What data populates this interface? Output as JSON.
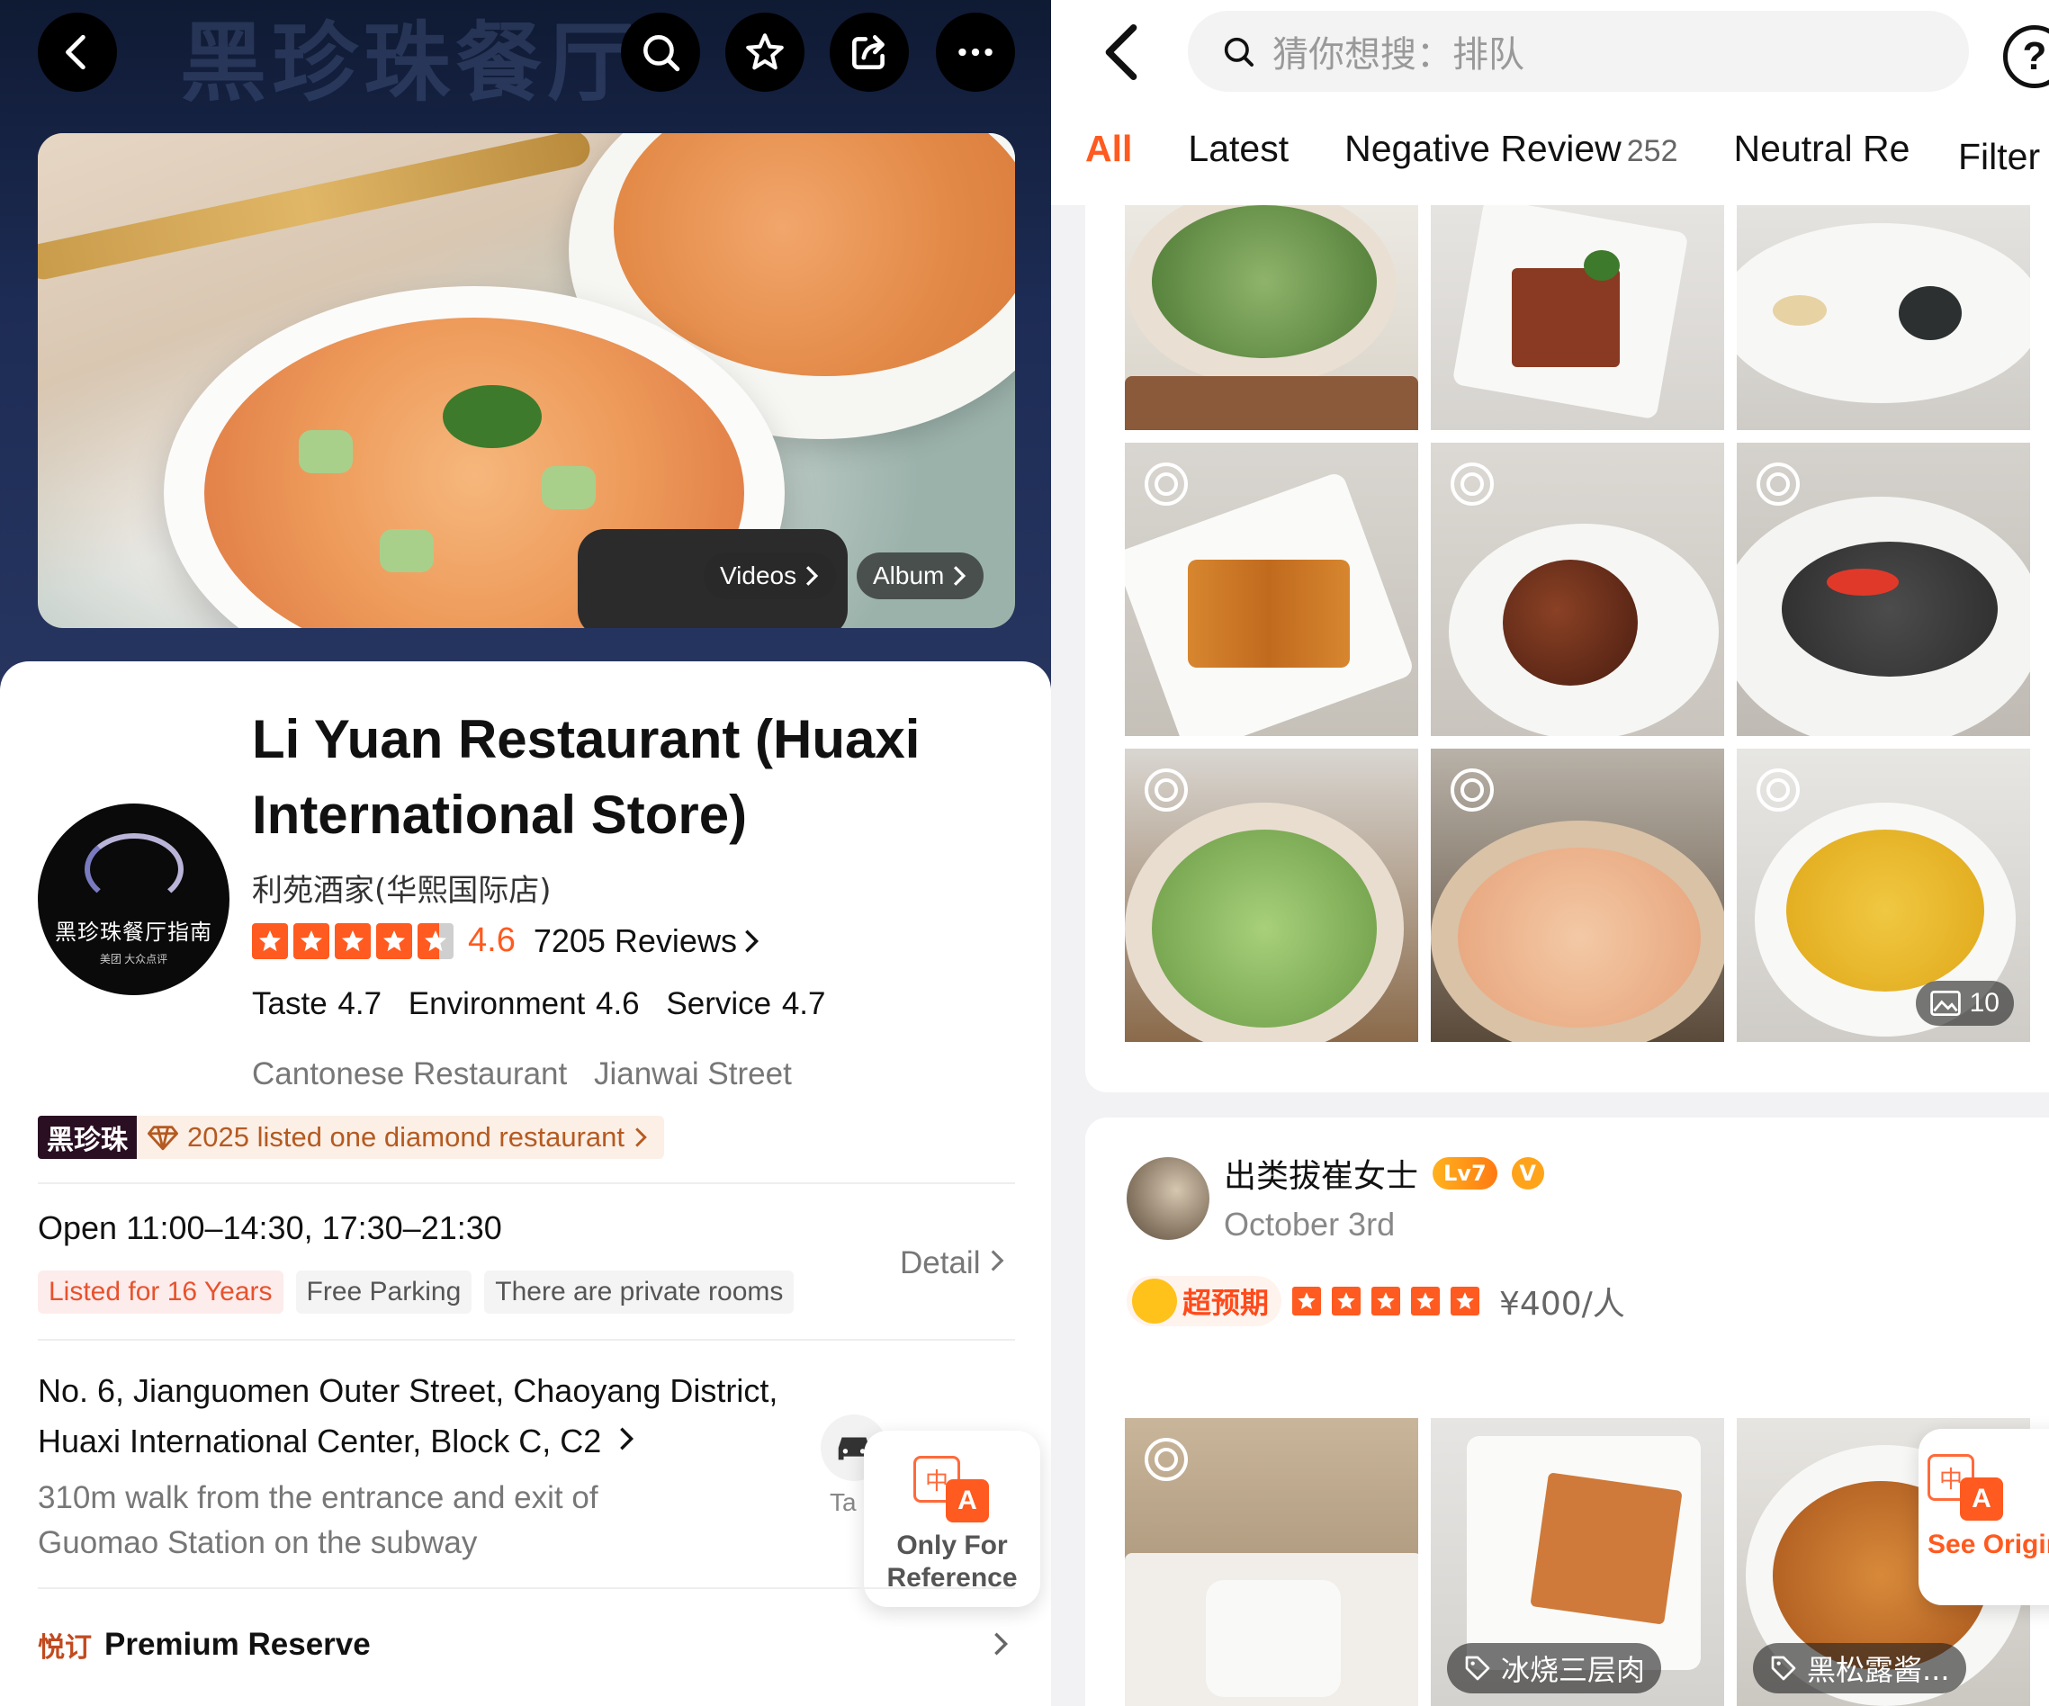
{
  "left": {
    "header": {
      "brand_watermark": "黑珍珠餐厅",
      "back_icon": "chevron-left-icon",
      "search_icon": "search-icon",
      "favorite_icon": "star-outline-icon",
      "share_icon": "share-icon",
      "more_icon": "more-dots-icon"
    },
    "media": {
      "videos_label": "Videos",
      "album_label": "Album"
    },
    "logo": {
      "name": "黑珍珠餐厅指南",
      "sub": "美团 大众点评"
    },
    "restaurant": {
      "title": "Li Yuan Restaurant (Huaxi International Store)",
      "chinese_name": "利苑酒家(华熙国际店)",
      "rating": "4.6",
      "stars": 4.6,
      "reviews": "7205 Reviews",
      "taste": "Taste 4.7",
      "environment": "Environment 4.6",
      "service": "Service 4.7",
      "category": "Cantonese Restaurant",
      "area": "Jianwai Street"
    },
    "badge": {
      "logo_text": "黑珍珠",
      "text": "2025 listed one diamond restaurant"
    },
    "hours": {
      "text": "Open  11:00–14:30, 17:30–21:30",
      "detail_label": "Detail"
    },
    "tags": [
      "Listed for 16 Years",
      "Free Parking",
      "There are private rooms"
    ],
    "address": {
      "text": "No. 6, Jianguomen Outer Street, Chaoyang District, Huaxi International Center, Block C, C2",
      "walk": "310m walk from the entrance and exit of Guomao Station on the subway",
      "taxi_label": "Ta"
    },
    "translate_popup": {
      "icon_a": "中",
      "icon_b": "A",
      "text": "Only For Reference"
    },
    "premium": {
      "icon_text": "悦订",
      "label": "Premium Reserve"
    }
  },
  "right": {
    "search": {
      "placeholder": "猜你想搜：排队"
    },
    "help_label": "?",
    "tabs": [
      {
        "label": "All",
        "active": true
      },
      {
        "label": "Latest"
      },
      {
        "label": "Negative Review",
        "count": "252"
      },
      {
        "label": "Neutral Re"
      }
    ],
    "filter_label": "Filter",
    "photo_count": "10",
    "review": {
      "username": "出类拔崔女士",
      "level": "Lv7",
      "verified": "V",
      "date": "October 3rd",
      "beyond_label": "超预期",
      "stars": 5,
      "price": "¥400/人"
    },
    "dish_tags": [
      "冰烧三层肉",
      "黑松露酱..."
    ],
    "see_original": {
      "icon_a": "中",
      "icon_b": "A",
      "text": "See Original"
    }
  }
}
